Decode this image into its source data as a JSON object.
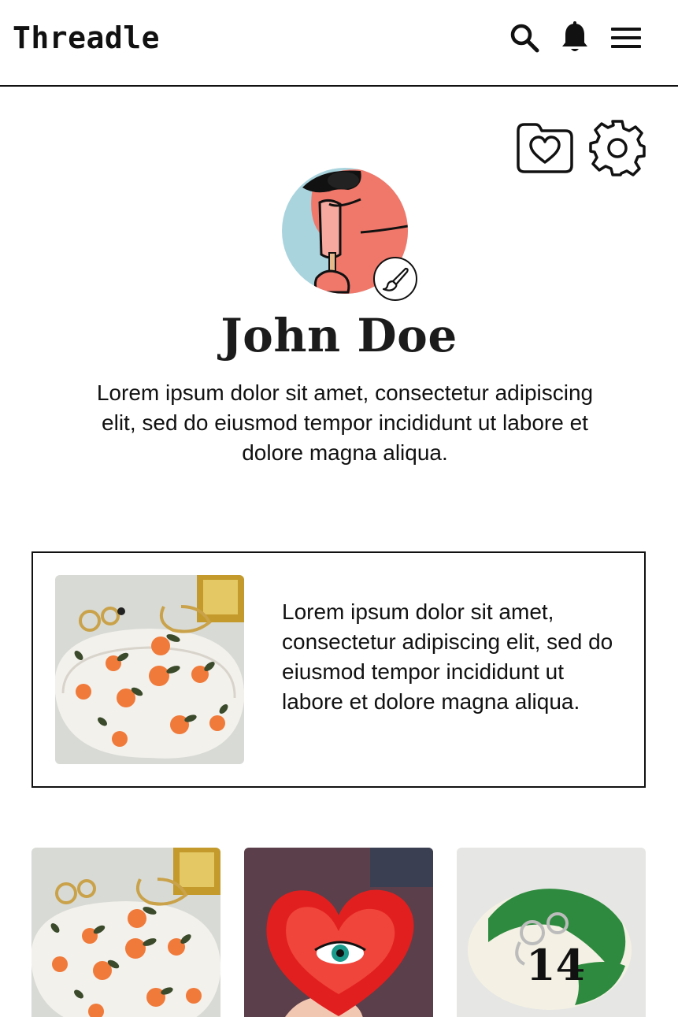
{
  "header": {
    "brand": "Threadle",
    "icons": [
      "search-icon",
      "bell-icon",
      "menu-icon"
    ]
  },
  "profile": {
    "actions": [
      "folder-heart-icon",
      "gear-icon"
    ],
    "avatar_edit_icon": "paintbrush-icon",
    "name": "John Doe",
    "bio": "Lorem ipsum dolor sit amet, consectetur adipiscing elit, sed do eiusmod tempor incididunt ut labore et dolore magna aliqua."
  },
  "featured": {
    "text": "Lorem ipsum dolor sit amet, consectetur adipiscing elit, sed do eiusmod tempor incididunt ut labore et dolore magna aliqua."
  },
  "grid": [
    {
      "name": "oval-orange-dish"
    },
    {
      "name": "red-heart-eye-dish"
    },
    {
      "name": "green-14-dish"
    }
  ],
  "colors": {
    "accent_dark": "#111111",
    "avatar_bg_blue": "#a9d4de",
    "avatar_face": "#f0786b",
    "heart_red": "#e21f1f",
    "dish_green": "#2e8a3e"
  }
}
